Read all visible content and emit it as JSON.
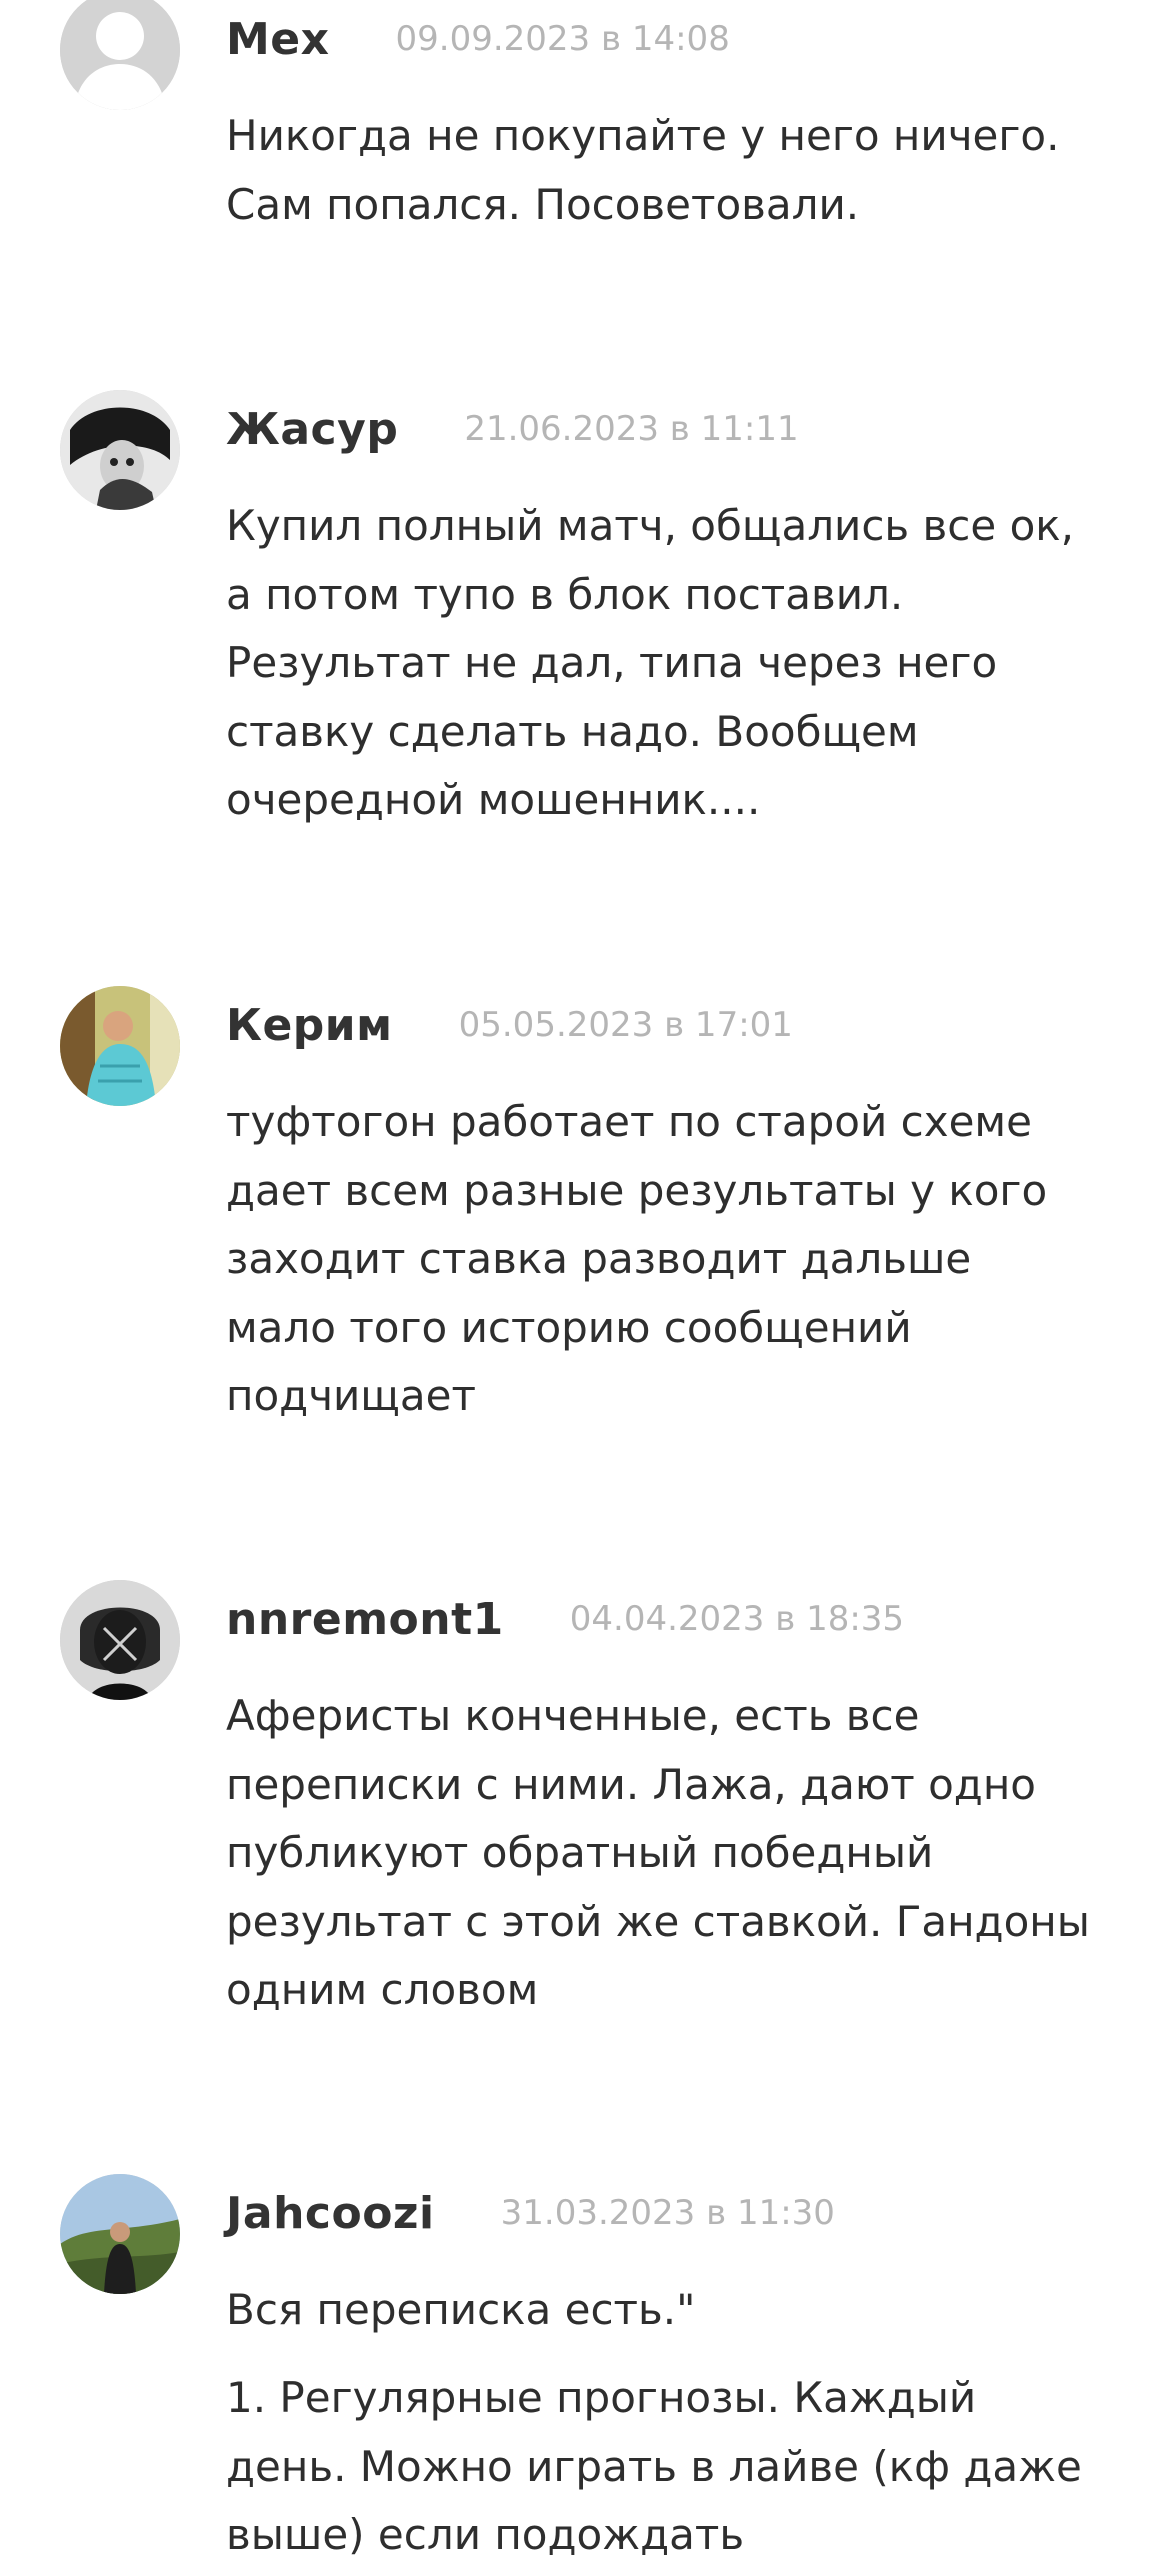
{
  "comments": [
    {
      "author": "Mex",
      "date": "09.09.2023 в 14:08",
      "avatar": "default-user-icon",
      "lines": [
        "Никогда не покупайте у него ничего.",
        "Сам попался. Посоветовали."
      ]
    },
    {
      "author": "Жасур",
      "date": "21.06.2023 в 11:11",
      "avatar": "user-photo",
      "lines": [
        "Купил полный матч, общались все ок,",
        "а потом тупо в блок поставил.",
        "Результат не дал, типа через него",
        "ставку сделать надо. Вообщем",
        "очередной мошенник...."
      ]
    },
    {
      "author": "Керим",
      "date": "05.05.2023 в 17:01",
      "avatar": "user-photo",
      "lines": [
        "туфтогон работает по старой схеме",
        "дает всем разные результаты у кого",
        "заходит ставка разводит дальше",
        "мало того историю сообщений",
        "подчищает"
      ]
    },
    {
      "author": "nnremont1",
      "date": "04.04.2023 в 18:35",
      "avatar": "user-photo",
      "lines": [
        "Аферисты конченные, есть все",
        "переписки с ними. Лажа, дают одно",
        "публикуют обратный победный",
        "результат с этой же ставкой. Гандоны",
        "одним словом"
      ]
    },
    {
      "author": "Jahcoozi",
      "date": "31.03.2023 в 11:30",
      "avatar": "user-photo",
      "lines": [
        "Вся переписка есть.\""
      ],
      "lines2": [
        "1. Регулярные прогнозы. Каждый",
        "день. Можно играть в лайве (кф даже",
        "выше) если подождать"
      ]
    }
  ]
}
